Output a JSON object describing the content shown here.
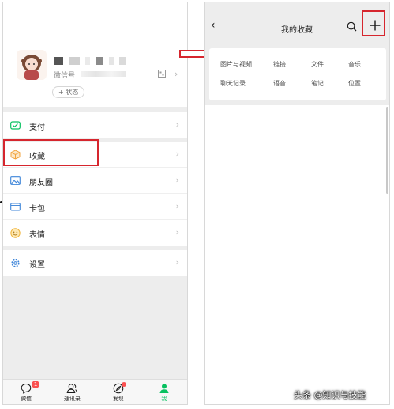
{
  "profile": {
    "wechat_id_label": "微信号",
    "status_label": "+ 状态"
  },
  "menu": {
    "pay": "支付",
    "favorites": "收藏",
    "moments": "朋友圈",
    "cards": "卡包",
    "stickers": "表情",
    "settings": "设置"
  },
  "tabbar": {
    "chats": "微信",
    "chats_badge": "1",
    "contacts": "通讯录",
    "discover": "发现",
    "me": "我"
  },
  "favorites_page": {
    "title": "我的收藏",
    "categories": [
      "图片与视频",
      "链接",
      "文件",
      "音乐",
      "聊天记录",
      "语音",
      "笔记",
      "位置"
    ]
  },
  "watermark": "头条 @知识与技能",
  "colors": {
    "accent_green": "#07c160",
    "highlight_red": "#d6262e",
    "badge_red": "#fa5151",
    "page_gray": "#ededed"
  },
  "icons": {
    "pay": "pay-icon",
    "favorites": "cube-icon",
    "moments": "image-icon",
    "cards": "wallet-icon",
    "stickers": "smiley-icon",
    "settings": "gear-icon"
  }
}
